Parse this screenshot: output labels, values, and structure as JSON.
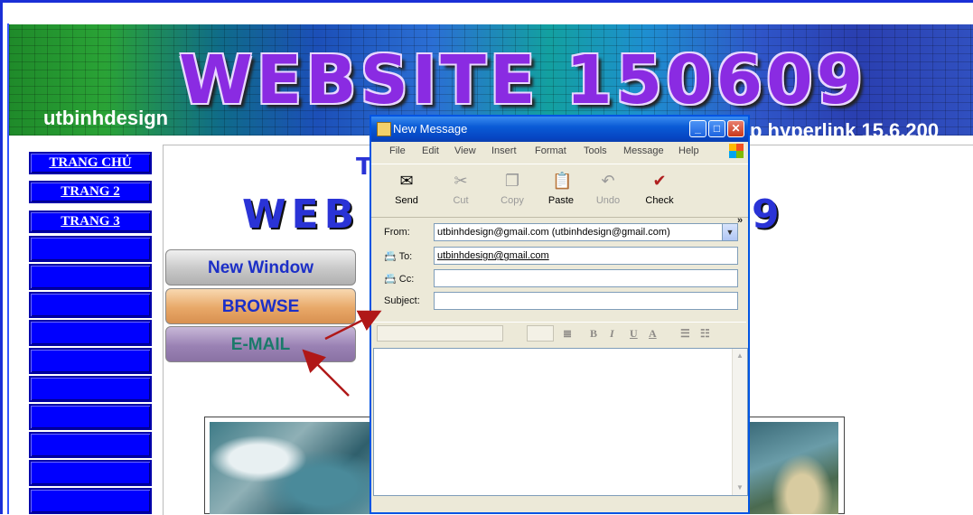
{
  "banner": {
    "title": "WEBSITE 150609",
    "brand": "utbinhdesign",
    "caption": "p hyperlink 15.6.200"
  },
  "sidebar": {
    "items": [
      {
        "label": "TRANG CHỦ"
      },
      {
        "label": "TRANG 2"
      },
      {
        "label": "TRANG 3"
      }
    ]
  },
  "content": {
    "watermark_left": "WEB",
    "watermark_right": "9",
    "watermark_top": "T",
    "buttons": {
      "new_window": "New Window",
      "browse": "BROWSE",
      "email": "E-MAIL"
    }
  },
  "dialog": {
    "title": "New Message",
    "menu": [
      "File",
      "Edit",
      "View",
      "Insert",
      "Format",
      "Tools",
      "Message",
      "Help"
    ],
    "toolbar": [
      {
        "label": "Send",
        "icon": "send-icon",
        "enabled": true
      },
      {
        "label": "Cut",
        "icon": "cut-icon",
        "enabled": false
      },
      {
        "label": "Copy",
        "icon": "copy-icon",
        "enabled": false
      },
      {
        "label": "Paste",
        "icon": "paste-icon",
        "enabled": true
      },
      {
        "label": "Undo",
        "icon": "undo-icon",
        "enabled": false
      },
      {
        "label": "Check",
        "icon": "check-names-icon",
        "enabled": true
      }
    ],
    "from_label": "From:",
    "from_value": "utbinhdesign@gmail.com   (utbinhdesign@gmail.com)",
    "to_label": "To:",
    "to_value": "utbinhdesign@gmail.com",
    "cc_label": "Cc:",
    "cc_value": "",
    "subject_label": "Subject:",
    "subject_value": ""
  },
  "colors": {
    "page_border": "#1a2fd6",
    "sidebar_blue": "#0000ff",
    "title_purple": "#8a2be2",
    "xp_titlebar": "#0a5bd6",
    "arrow": "#b01818"
  }
}
